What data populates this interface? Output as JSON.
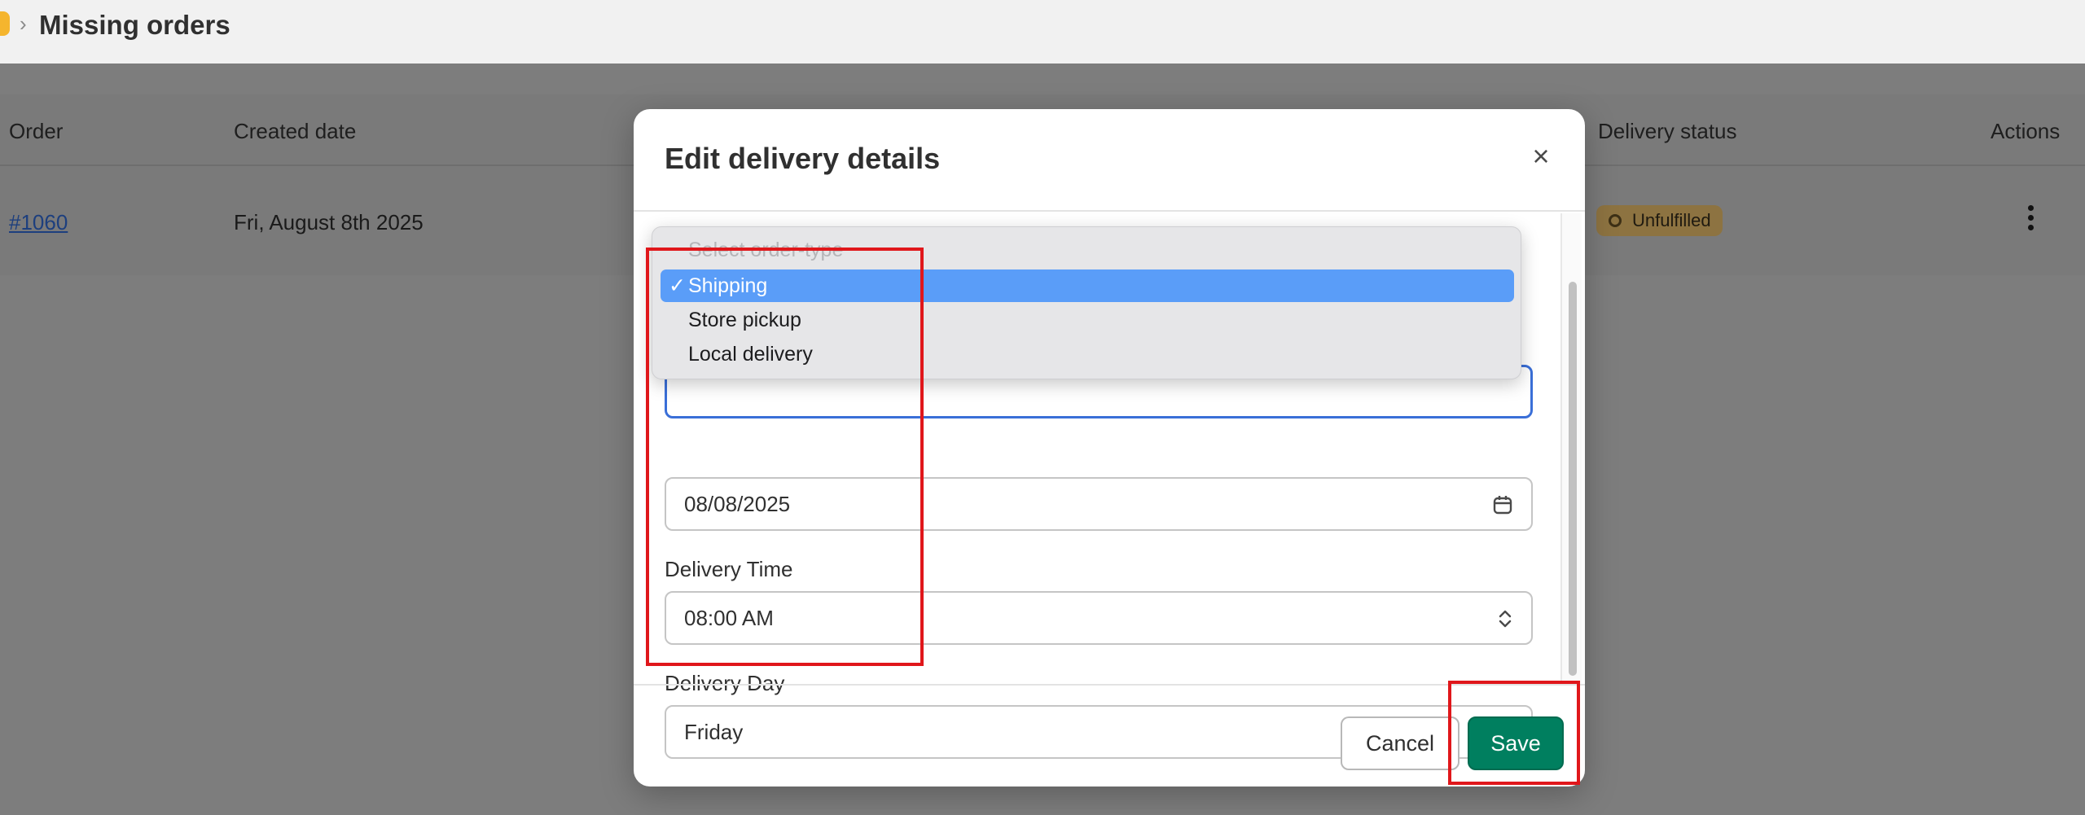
{
  "header": {
    "breadcrumb_separator": "›",
    "title": "Missing orders"
  },
  "table": {
    "columns": [
      "Order",
      "Created date",
      "Delivery status",
      "Actions"
    ],
    "rows": [
      {
        "order": "#1060",
        "created_date": "Fri, August 8th 2025",
        "delivery_status": "Unfulfilled"
      }
    ]
  },
  "modal": {
    "title": "Edit delivery details",
    "close_glyph": "×",
    "fields": {
      "delivery_date": {
        "value": "08/08/2025"
      },
      "delivery_time": {
        "label": "Delivery Time",
        "value": "08:00 AM"
      },
      "delivery_day": {
        "label": "Delivery Day",
        "value": "Friday"
      }
    },
    "cancel_label": "Cancel",
    "save_label": "Save"
  },
  "dropdown": {
    "options": [
      {
        "label": "Select order-type",
        "placeholder": true
      },
      {
        "label": "Shipping",
        "selected": true
      },
      {
        "label": "Store pickup"
      },
      {
        "label": "Local delivery"
      }
    ],
    "check_glyph": "✓"
  },
  "icons": {
    "calendar": "calendar-icon",
    "select_arrows": "chevron-up-down-icon",
    "kebab": "more-vertical-icon"
  },
  "colors": {
    "primary_button": "#007f5f",
    "selection": "#5a9df8",
    "annotation": "#e0171b",
    "status_badge": "#8d7341"
  }
}
